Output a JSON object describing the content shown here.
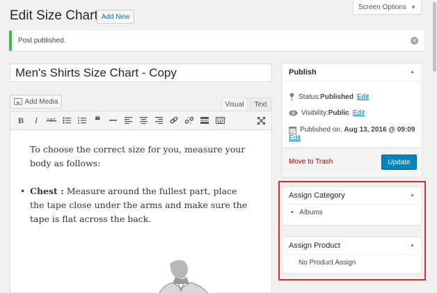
{
  "header": {
    "title": "Edit Size Charts",
    "add_new": "Add New",
    "screen_options": "Screen Options"
  },
  "notice": {
    "text": "Post published."
  },
  "post": {
    "title": "Men's Shirts Size Chart - Copy"
  },
  "editor": {
    "add_media": "Add Media",
    "tabs": {
      "visual": "Visual",
      "text": "Text"
    },
    "toolbar": [
      "bold",
      "italic",
      "strikethrough",
      "bulleted-list",
      "numbered-list",
      "blockquote",
      "horizontal-line",
      "align-left",
      "align-center",
      "align-right",
      "insert-link",
      "remove-link",
      "read-more",
      "toolbar-toggle",
      "fullscreen"
    ],
    "intro": "To choose the correct size for you, measure your body as follows:",
    "chest_label": "Chest :",
    "chest_text": " Measure around the fullest part, place the tape close under the arms and make sure the tape is flat across the back."
  },
  "publish": {
    "title": "Publish",
    "status_label": "Status: ",
    "status_value": "Published",
    "visibility_label": "Visibility: ",
    "visibility_value": "Public",
    "published_on_label": "Published on: ",
    "published_on_value": "Aug 13, 2016 @ 09:09",
    "edit": "Edit",
    "move_to_trash": "Move to Trash",
    "update": "Update"
  },
  "assign_category": {
    "title": "Assign Category",
    "items": [
      "Albums"
    ]
  },
  "assign_product": {
    "title": "Assign Product",
    "empty": "No Product Assign"
  },
  "colors": {
    "accent": "#0085ba",
    "link": "#0073aa",
    "success": "#46b450",
    "trash": "#aa0000",
    "highlight": "#e0242b"
  }
}
